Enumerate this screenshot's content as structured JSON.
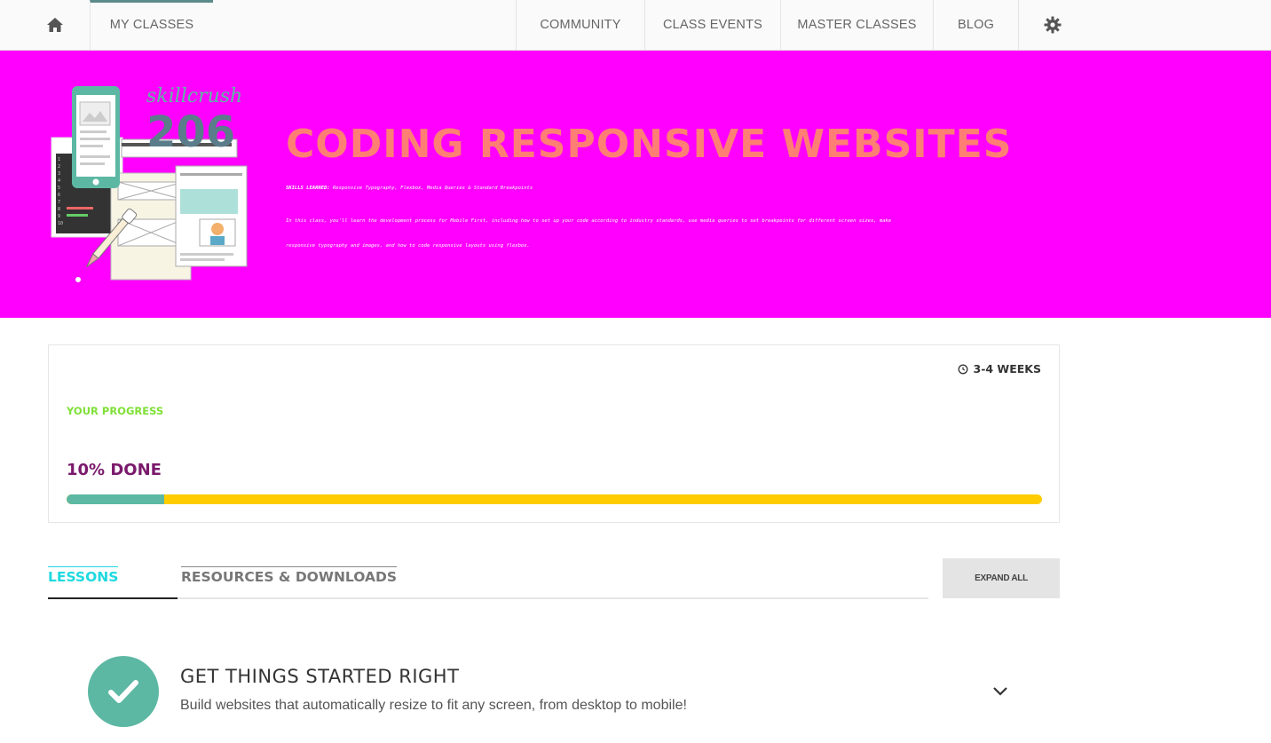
{
  "nav": {
    "home_icon": "home-icon",
    "my_classes": "MY CLASSES",
    "community": "COMMUNITY",
    "class_events": "CLASS EVENTS",
    "master_classes": "MASTER CLASSES",
    "blog": "BLOG",
    "settings_icon": "gear-icon"
  },
  "hero": {
    "background": "#ff00ff",
    "logo_text": "skillcrush",
    "logo_number": "206",
    "title": "CODING RESPONSIVE WEBSITES",
    "title_color": "#ff7f74",
    "skills_label": "SKILLS LEARNED:",
    "skills": "Responsive Typography, Flexbox, Media Queries & Standard Breakpoints",
    "description": "In this class, you'll learn the development process for Mobile First, including how to set up your code according to industry standards, use media queries to set breakpoints for different screen sizes, make responsive typography and images, and how to code responsive layouts using flexbox."
  },
  "progress": {
    "duration_icon": "clock-icon",
    "duration": "3-4 WEEKS",
    "label": "YOUR PROGRESS",
    "done_text": "10% DONE",
    "percent": 10,
    "fill_color": "#5cb8a3",
    "track_color": "#ffcc00"
  },
  "tabs": {
    "lessons": "LESSONS",
    "resources": "RESOURCES & DOWNLOADS",
    "expand_all": "EXPAND ALL"
  },
  "lessons": [
    {
      "status_icon": "checkmark-icon",
      "title": "GET THINGS STARTED RIGHT",
      "subtitle": "Build websites that automatically resize to fit any screen, from desktop to mobile!",
      "toggle_icon": "chevron-down-icon"
    }
  ]
}
